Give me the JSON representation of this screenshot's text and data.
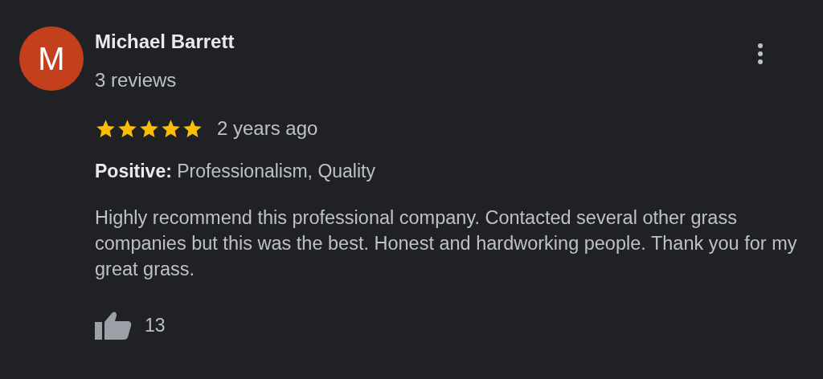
{
  "reviewer": {
    "initial": "M",
    "name": "Michael Barrett",
    "reviews": "3 reviews"
  },
  "review": {
    "stars": 5,
    "time": "2 years ago",
    "highlights": "**Positive:** Professionalism, Quality",
    "text": "Highly recommend this professional company. Contacted several other grass companies but this was the best. Honest and hardworking people. Thank you for my great grass.",
    "likes": "13"
  }
}
